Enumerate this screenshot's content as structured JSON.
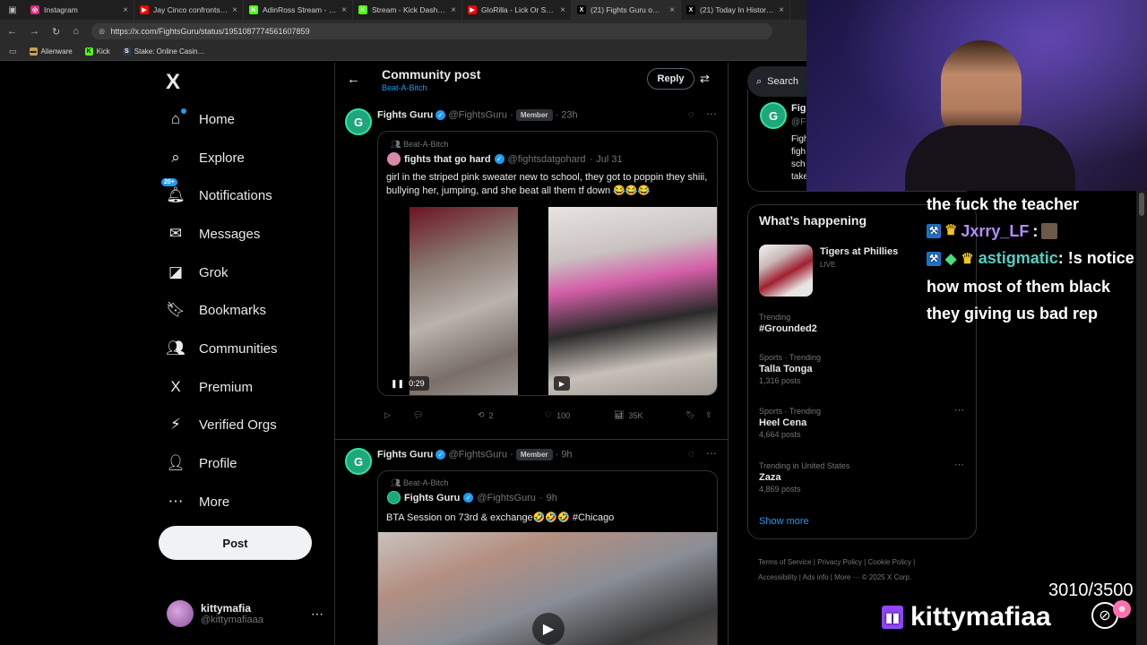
{
  "browser": {
    "tabs": [
      {
        "title": "Instagram",
        "color": "#d62976",
        "glyph": "◎"
      },
      {
        "title": "Jay Cinco confronts Al…",
        "color": "#ff0000",
        "glyph": "▶"
      },
      {
        "title": "AdinRoss Stream - Wa…",
        "color": "#53fc18",
        "glyph": "K"
      },
      {
        "title": "Stream - Kick Dashboa…",
        "color": "#53fc18",
        "glyph": "K"
      },
      {
        "title": "GloRilla - Lick Or Sum …",
        "color": "#ff0000",
        "glyph": "▶"
      },
      {
        "title": "(21) Fights Guru o…",
        "color": "#000000",
        "glyph": "X"
      },
      {
        "title": "(21) Today In History c…",
        "color": "#000000",
        "glyph": "X"
      }
    ],
    "url": "https://x.com/FightsGuru/status/1951087774561607859",
    "bookmarks": [
      {
        "label": "Alienware"
      },
      {
        "label": "Kick"
      },
      {
        "label": "Stake: Online Casin…"
      }
    ]
  },
  "nav": {
    "logo": "X",
    "items": [
      {
        "label": "Home",
        "icon": "⌂"
      },
      {
        "label": "Explore",
        "icon": "⌕"
      },
      {
        "label": "Notifications",
        "icon": "🔔︎",
        "badge": "20+"
      },
      {
        "label": "Messages",
        "icon": "✉"
      },
      {
        "label": "Grok",
        "icon": "◪"
      },
      {
        "label": "Bookmarks",
        "icon": "🔖︎"
      },
      {
        "label": "Communities",
        "icon": "👥︎"
      },
      {
        "label": "Premium",
        "icon": "X"
      },
      {
        "label": "Verified Orgs",
        "icon": "⚡︎"
      },
      {
        "label": "Profile",
        "icon": "👤︎"
      },
      {
        "label": "More",
        "icon": "⋯"
      }
    ],
    "post_label": "Post",
    "account": {
      "name": "kittymafia",
      "handle": "@kittymafiaaa"
    }
  },
  "header": {
    "title": "Community post",
    "community": "Beat-A-Bitch",
    "reply_label": "Reply"
  },
  "posts": [
    {
      "author": "Fights Guru",
      "handle": "@FightsGuru",
      "badge": "Member",
      "time": "23h",
      "quote": {
        "community": "Beat-A-Bitch",
        "author": "fights that go hard",
        "handle": "@fightsdatgohard",
        "date": "Jul 31",
        "text": "girl in the striped pink sweater new to school, they got to poppin they shiii, bullying her, jumping, and she beat all them tf down 😂😂😂",
        "video_time": "0:29"
      },
      "stats": {
        "reposts": "2",
        "likes": "100",
        "views": "35K"
      }
    },
    {
      "author": "Fights Guru",
      "handle": "@FightsGuru",
      "badge": "Member",
      "time": "9h",
      "quote": {
        "community": "Beat-A-Bitch",
        "author": "Fights Guru",
        "handle": "@FightsGuru",
        "date": "9h",
        "text": "BTA Session on 73rd & exchange🤣🤣🤣 #Chicago"
      }
    }
  ],
  "right": {
    "search_placeholder": "Search",
    "top_card": {
      "name": "Figh",
      "handle": "@Fi",
      "lines": [
        "Figh",
        "figh",
        "sch",
        "take"
      ]
    },
    "happening_title": "What’s happening",
    "featured": {
      "title": "Tigers at Phillies",
      "status": "LIVE"
    },
    "trends": [
      {
        "meta": "Trending",
        "name": "#Grounded2",
        "count": ""
      },
      {
        "meta": "Sports · Trending",
        "name": "Talla Tonga",
        "count": "1,316 posts"
      },
      {
        "meta": "Sports · Trending",
        "name": "Heel Cena",
        "count": "4,664 posts"
      },
      {
        "meta": "Trending in United States",
        "name": "Zaza",
        "count": "4,869 posts"
      }
    ],
    "show_more": "Show more",
    "footer": [
      "Terms of Service",
      "Privacy Policy",
      "Cookie Policy",
      "Accessibility",
      "Ads info",
      "More ···",
      "© 2025 X Corp."
    ]
  },
  "stream": {
    "chat": [
      {
        "user": "",
        "text": "the fuck the teacher"
      },
      {
        "user": "Jxrry_LF",
        "user_color": "#b48cff",
        "text": ":"
      },
      {
        "user": "astigmatic",
        "user_color": "#4fd1c5",
        "text": ": !s notice how most of them black they giving us bad rep"
      }
    ],
    "goal": "3010/3500",
    "brand": "kittymafiaa"
  },
  "colors": {
    "accent": "#1d9bf0",
    "twitch": "#9146ff"
  }
}
